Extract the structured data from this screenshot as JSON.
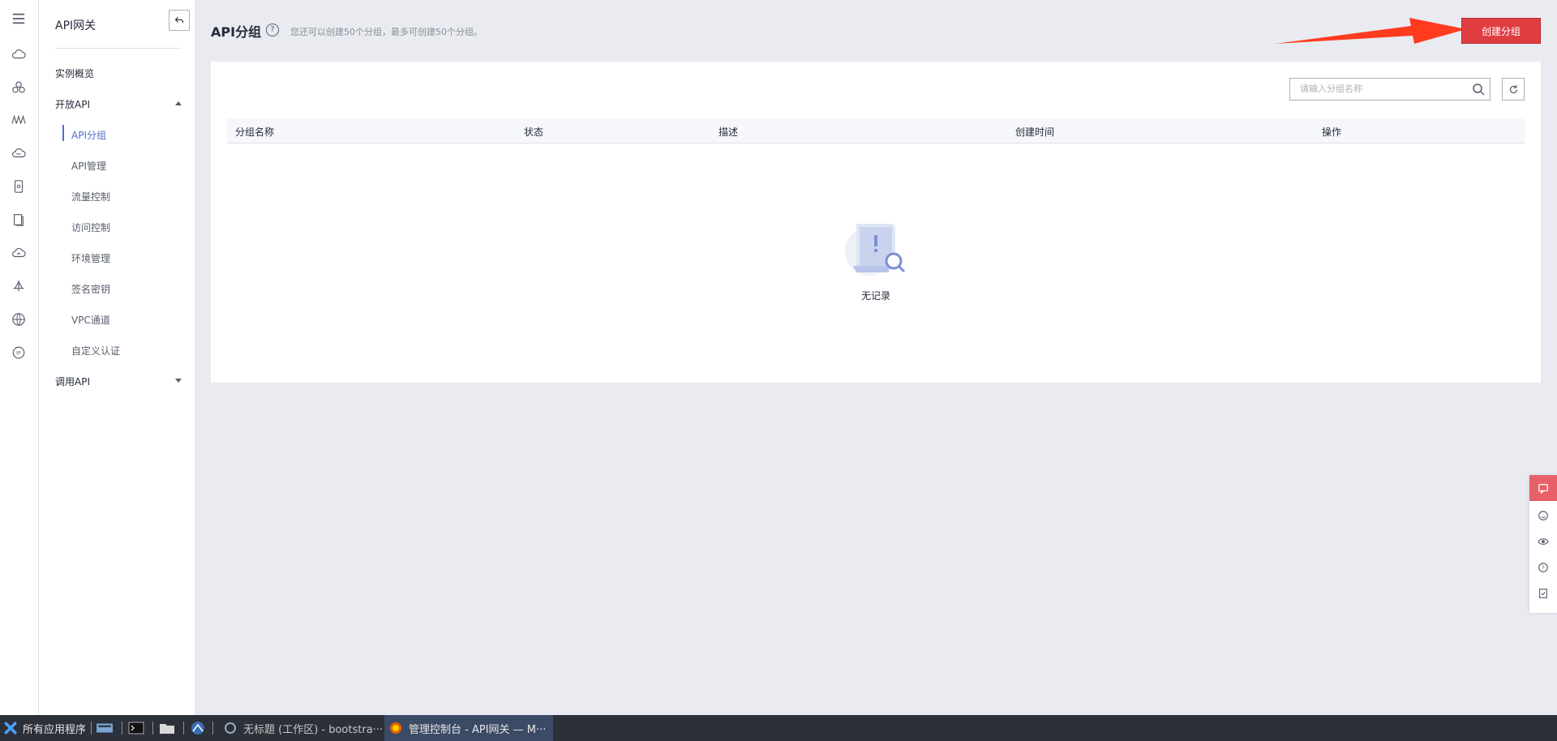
{
  "menu": {
    "title": "API网关",
    "items": {
      "overview": "实例概览",
      "open_api": "开放API",
      "api_group": "API分组",
      "api_manage": "API管理",
      "flow_control": "流量控制",
      "access_control": "访问控制",
      "env_manage": "环境管理",
      "sign_key": "签名密钥",
      "vpc_channel": "VPC通道",
      "custom_auth": "自定义认证",
      "call_api": "调用API"
    }
  },
  "header": {
    "title": "API分组",
    "quota_text": "您还可以创建50个分组，最多可创建50个分组。",
    "create_button": "创建分组"
  },
  "search": {
    "placeholder": "请输入分组名称",
    "value": ""
  },
  "table": {
    "columns": [
      "分组名称",
      "状态",
      "描述",
      "创建时间",
      "操作"
    ],
    "rows": [],
    "empty_text": "无记录"
  },
  "taskbar": {
    "start": "所有应用程序",
    "window_1": "无标题 (工作区) - bootstra···",
    "window_2": "管理控制台 - API网关 — M···"
  },
  "colors": {
    "accent_red": "#e03d43",
    "active_blue": "#526ecc",
    "annotation_arrow": "#ff3b1f"
  },
  "icons": {
    "rail": [
      "hamburger-menu-icon",
      "cloud-icon",
      "cluster-icon",
      "bridge-icon",
      "cloud-service-icon",
      "phone-icon",
      "document-icon",
      "cloud-connect-icon",
      "anchor-icon",
      "globe-icon",
      "ip-icon"
    ],
    "float_tools": [
      "chat-icon",
      "smile-icon",
      "eye-icon",
      "question-icon",
      "checklist-icon"
    ]
  }
}
